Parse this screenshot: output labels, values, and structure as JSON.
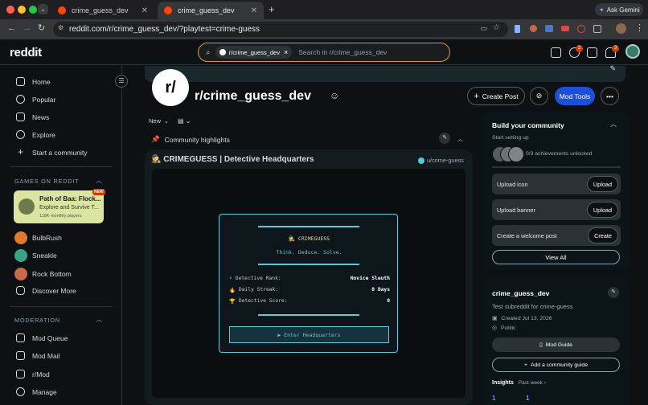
{
  "browser": {
    "tabs": [
      {
        "title": "crime_guess_dev",
        "active": false
      },
      {
        "title": "crime_guess_dev",
        "active": true
      }
    ],
    "url": "reddit.com/r/crime_guess_dev/?playtest=crime-guess",
    "ask_gemini": "Ask Gemini"
  },
  "header": {
    "logo": "reddit",
    "search_chip": "r/crime_guess_dev",
    "search_chip_close": "×",
    "search_placeholder": "Search in r/crime_guess_dev",
    "chat_badge": "2",
    "notif_badge": "3"
  },
  "sidebar": {
    "nav": [
      {
        "label": "Home",
        "icon": "home-icon"
      },
      {
        "label": "Popular",
        "icon": "popular-icon"
      },
      {
        "label": "News",
        "icon": "news-icon"
      },
      {
        "label": "Explore",
        "icon": "explore-icon"
      },
      {
        "label": "Start a community",
        "icon": "plus-icon"
      }
    ],
    "games_header": "GAMES ON REDDIT",
    "featured_game": {
      "title": "Path of Baa: Flock...",
      "subtitle": "Explore and Survive T...",
      "players": "118K monthly players",
      "badge": "NEW"
    },
    "games": [
      {
        "label": "BulbRush",
        "color": "#e07a2c"
      },
      {
        "label": "Sneakle",
        "color": "#3aa28a"
      },
      {
        "label": "Rock Bottom",
        "color": "#c96a4a"
      },
      {
        "label": "Discover More",
        "color": ""
      }
    ],
    "moderation_header": "MODERATION",
    "moderation": [
      {
        "label": "Mod Queue"
      },
      {
        "label": "Mod Mail"
      },
      {
        "label": "r/Mod"
      },
      {
        "label": "Manage"
      }
    ]
  },
  "community": {
    "avatar_text": "r/",
    "name": "r/crime_guess_dev",
    "create_post": "Create Post",
    "mod_tools": "Mod Tools",
    "sort": "New",
    "highlights": "Community highlights"
  },
  "post": {
    "title": "🕵 CRIMEGUESS | Detective Headquarters",
    "author": "u/crime-guess",
    "game": {
      "brand": "🕵 CRIMEGUESS",
      "tagline": "Think. Deduce. Solve.",
      "stats": [
        {
          "icon": "⚡",
          "label": "Detective Rank:",
          "value": "Novice Sleuth"
        },
        {
          "icon": "🔥",
          "label": "Daily Streak:",
          "value": "0 Days"
        },
        {
          "icon": "🏆",
          "label": "Detective Score:",
          "value": "0"
        }
      ],
      "enter_button": "▶ Enter Headquarters"
    }
  },
  "build": {
    "title": "Build your community",
    "start": "Start setting up",
    "achievements": "0/3 achievements unlocked",
    "rows": [
      {
        "label": "Upload icon",
        "button": "Upload"
      },
      {
        "label": "Upload banner",
        "button": "Upload"
      },
      {
        "label": "Create a welcome post",
        "button": "Create"
      }
    ],
    "view_all": "View All"
  },
  "about": {
    "name": "crime_guess_dev",
    "description": "Test subreddit for crime-guess",
    "created": "Created Jul 13, 2026",
    "visibility": "Public",
    "mod_guide": "Mod Guide",
    "add_guide": "Add a community guide",
    "insights": "Insights",
    "period": "Past week",
    "stat1": "1",
    "stat2": "1"
  },
  "colors": {
    "accent_orange": "#ff4500",
    "mod_tools_blue": "#1d4fd8",
    "game_cyan": "#5bc8dc",
    "featured_game_bg": "#dbe5a1"
  }
}
